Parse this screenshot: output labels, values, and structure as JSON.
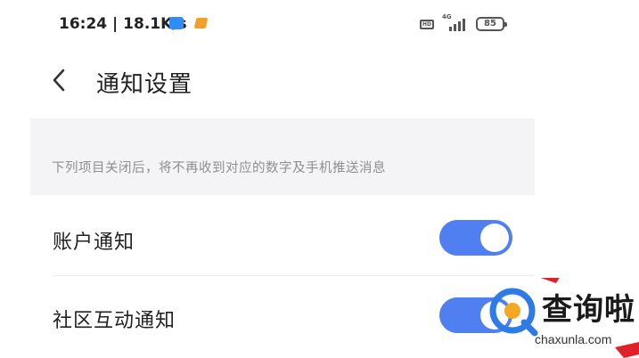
{
  "status_bar": {
    "time_speed": "16:24 | 18.1K/s",
    "hd_label": "HD",
    "network_type": "4G",
    "battery_level": "85"
  },
  "header": {
    "title": "通知设置"
  },
  "info": {
    "text": "下列项目关闭后，将不再收到对应的数字及手机推送消息"
  },
  "settings": [
    {
      "label": "账户通知",
      "enabled": true
    },
    {
      "label": "社区互动通知",
      "enabled": true
    }
  ],
  "watermark": {
    "brand": "查询啦",
    "url": "chaxunla.com"
  },
  "colors": {
    "toggle_on": "#4f7ff0",
    "annotation_arrow": "#e0202a",
    "logo_blue": "#2e7be8",
    "logo_orange": "#f5a623"
  }
}
